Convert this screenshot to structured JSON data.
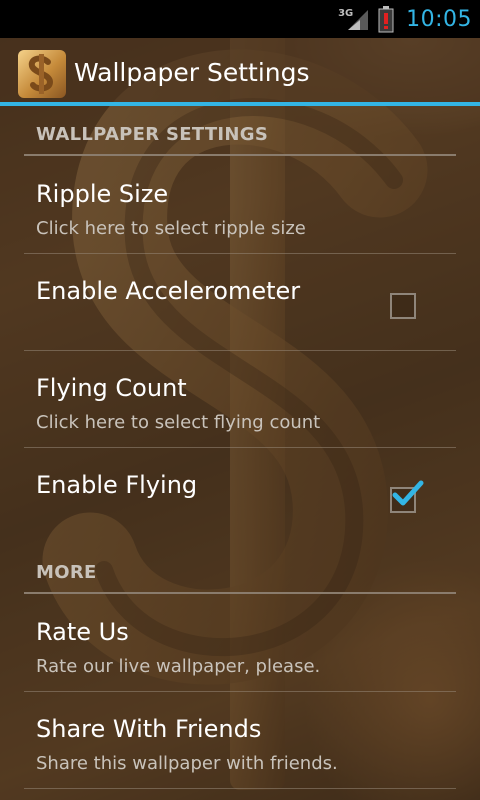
{
  "status_bar": {
    "network_type": "3G",
    "time": "10:05",
    "icons": [
      "signal-icon",
      "battery-alert-icon"
    ]
  },
  "action_bar": {
    "title": "Wallpaper Settings",
    "icon": "dollar-app-icon"
  },
  "sections": [
    {
      "header": "WALLPAPER SETTINGS",
      "items": [
        {
          "title": "Ripple Size",
          "summary": "Click here to select ripple size"
        },
        {
          "title": "Enable Accelerometer",
          "checked": false
        },
        {
          "title": "Flying Count",
          "summary": "Click here to select flying count"
        },
        {
          "title": "Enable Flying",
          "checked": true
        }
      ]
    },
    {
      "header": "MORE",
      "items": [
        {
          "title": "Rate Us",
          "summary": "Rate our live wallpaper, please."
        },
        {
          "title": "Share With Friends",
          "summary": "Share this wallpaper with friends."
        }
      ]
    }
  ],
  "colors": {
    "accent": "#33b5e5",
    "status_bar": "#000000",
    "section_header_text": "#c8c2ba",
    "title_text": "#ffffff",
    "summary_text": "#c9c3bb"
  }
}
